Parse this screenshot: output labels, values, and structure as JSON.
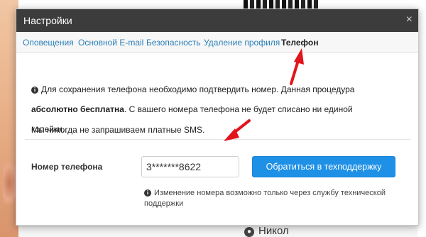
{
  "dialog": {
    "title": "Настройки",
    "close_label": "×"
  },
  "tabs": [
    {
      "label": "Оповещения",
      "active": false
    },
    {
      "label": "Основной E-mail",
      "active": false
    },
    {
      "label": "Безопасность",
      "active": false
    },
    {
      "label": "Удаление профиля",
      "active": false
    },
    {
      "label": "Телефон",
      "active": true
    }
  ],
  "notice": {
    "line1": "Для сохранения телефона необходимо подтвердить номер. Данная процедура",
    "bold": "абсолютно бесплатна",
    "line2_rest": ". С вашего номера телефона не будет списано ни единой копейки.",
    "line3": "Мы никогда не запрашиваем платные SMS."
  },
  "phone": {
    "label": "Номер телефона",
    "value": "3*******8622",
    "button_label": "Обратиться в техподдержку",
    "hint": "Изменение номера возможно только через службу технической поддержки"
  },
  "background": {
    "name_fragment": "Никол",
    "pin_icon": "map-pin-icon"
  },
  "colors": {
    "header_bg": "#3c3c3c",
    "link": "#2a80b9",
    "button": "#1e90e6",
    "arrow": "#e2141c"
  }
}
